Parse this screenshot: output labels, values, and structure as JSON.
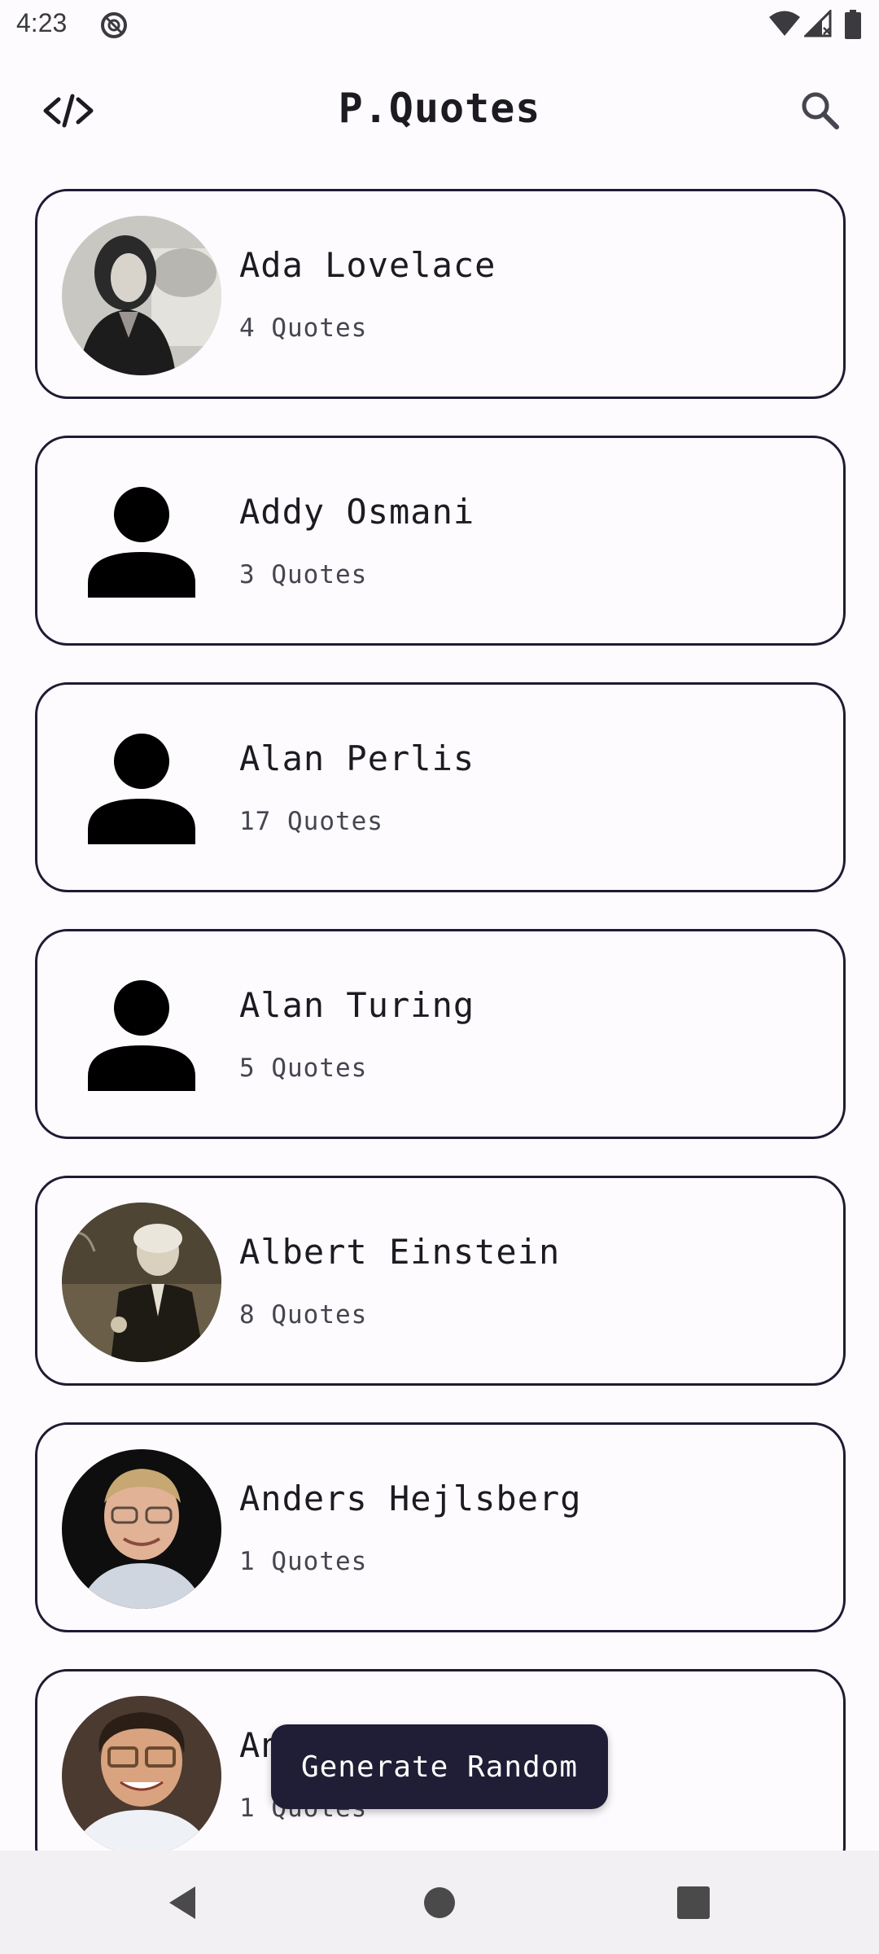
{
  "status_bar": {
    "time": "4:23",
    "icons": [
      "do-not-disturb-icon",
      "wifi-icon",
      "signal-icon",
      "battery-icon"
    ]
  },
  "app_bar": {
    "title": "P.Quotes",
    "leading_icon": "code-icon",
    "trailing_icon": "search-icon"
  },
  "authors": [
    {
      "name": "Ada Lovelace",
      "count": "4 Quotes",
      "avatar": "photo"
    },
    {
      "name": "Addy Osmani",
      "count": "3 Quotes",
      "avatar": "person-placeholder-icon"
    },
    {
      "name": "Alan Perlis",
      "count": "17 Quotes",
      "avatar": "person-placeholder-icon"
    },
    {
      "name": "Alan Turing",
      "count": "5 Quotes",
      "avatar": "person-placeholder-icon"
    },
    {
      "name": "Albert Einstein",
      "count": "8 Quotes",
      "avatar": "photo"
    },
    {
      "name": "Anders Hejlsberg",
      "count": "1 Quotes",
      "avatar": "photo"
    },
    {
      "name": "An",
      "count": "1 Quotes",
      "avatar": "photo"
    }
  ],
  "generate_button": {
    "label": "Generate Random"
  },
  "nav_bar": {
    "icons": [
      "back-icon",
      "home-icon",
      "recents-icon"
    ]
  },
  "colors": {
    "background": "#fefbff",
    "card_border": "#1e1c33",
    "button_bg": "#1f1e36",
    "text_primary": "#1b1b21",
    "nav_bar": "#f3f0f4"
  }
}
